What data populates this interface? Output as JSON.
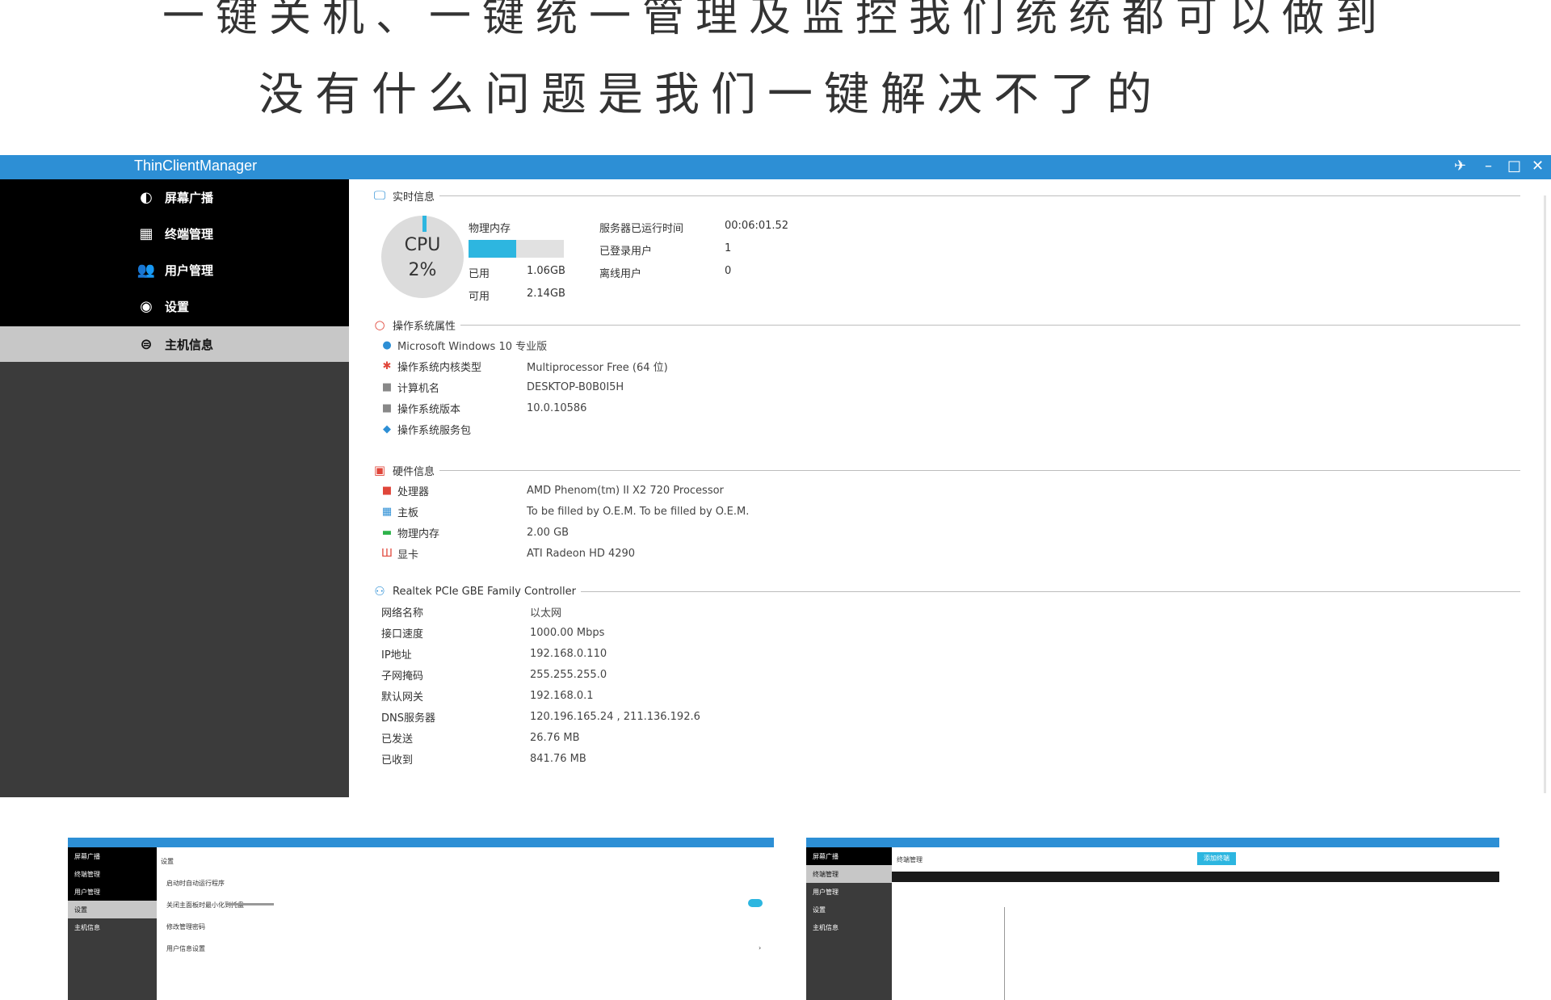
{
  "banner": {
    "line1": "一键关机、一键统一管理及监控我们统统都可以做到",
    "line2": "没有什么问题是我们一键解决不了的"
  },
  "window": {
    "title": "ThinClientManager",
    "controls": {
      "feedback": "✈",
      "minimize": "–",
      "maximize": "□",
      "close": "✕"
    }
  },
  "sidebar": {
    "items": [
      {
        "label": "屏幕广播",
        "icon": "broadcast-icon"
      },
      {
        "label": "终端管理",
        "icon": "terminal-icon"
      },
      {
        "label": "用户管理",
        "icon": "users-icon"
      },
      {
        "label": "设置",
        "icon": "settings-icon"
      },
      {
        "label": "主机信息",
        "icon": "host-info-icon",
        "active": true
      }
    ]
  },
  "realtime": {
    "title": "实时信息",
    "cpu_label": "CPU",
    "cpu_value": "2%",
    "cpu_fraction": 0.02,
    "mem_label": "物理内存",
    "mem_used_fraction": 0.5,
    "used_label": "已用",
    "used_value": "1.06GB",
    "avail_label": "可用",
    "avail_value": "2.14GB",
    "uptime_label": "服务器已运行时间",
    "uptime_value": "00:06:01.52",
    "logged_label": "已登录用户",
    "logged_value": "1",
    "offline_label": "离线用户",
    "offline_value": "0"
  },
  "os": {
    "title": "操作系统属性",
    "os_name": "Microsoft Windows 10 专业版",
    "rows": [
      {
        "label": "操作系统内核类型",
        "value": "Multiprocessor Free (64 位)",
        "icon": "kernel-icon"
      },
      {
        "label": "计算机名",
        "value": "DESKTOP-B0B0I5H",
        "icon": "computer-icon"
      },
      {
        "label": "操作系统版本",
        "value": "10.0.10586",
        "icon": "version-icon"
      },
      {
        "label": "操作系统服务包",
        "value": "",
        "icon": "service-pack-icon"
      }
    ]
  },
  "hardware": {
    "title": "硬件信息",
    "rows": [
      {
        "label": "处理器",
        "value": "AMD Phenom(tm) II X2 720 Processor",
        "icon": "cpu-icon"
      },
      {
        "label": "主板",
        "value": "To be filled by O.E.M. To be filled by O.E.M.",
        "icon": "motherboard-icon"
      },
      {
        "label": "物理内存",
        "value": "2.00 GB",
        "icon": "memory-icon"
      },
      {
        "label": "显卡",
        "value": "ATI Radeon HD 4290",
        "icon": "gpu-icon"
      }
    ]
  },
  "network": {
    "title": "Realtek PCIe GBE Family Controller",
    "rows": [
      {
        "label": "网络名称",
        "value": "以太网"
      },
      {
        "label": "接口速度",
        "value": "1000.00 Mbps"
      },
      {
        "label": "IP地址",
        "value": "192.168.0.110"
      },
      {
        "label": "子网掩码",
        "value": "255.255.255.0"
      },
      {
        "label": "默认网关",
        "value": "192.168.0.1"
      },
      {
        "label": "DNS服务器",
        "value": "120.196.165.24 , 211.136.192.6"
      },
      {
        "label": "已发送",
        "value": "26.76 MB"
      },
      {
        "label": "已收到",
        "value": "841.76 MB"
      }
    ]
  },
  "thumb1": {
    "nav": [
      "屏幕广播",
      "终端管理",
      "用户管理",
      "设置",
      "主机信息"
    ],
    "header": "设置",
    "rows": [
      "启动时自动运行程序",
      "关闭主面板时最小化到托盘",
      "修改管理密码",
      "用户信息设置"
    ]
  },
  "thumb2": {
    "nav": [
      "屏幕广播",
      "终端管理",
      "用户管理",
      "设置",
      "主机信息"
    ],
    "header": "终端管理",
    "button": "添加终端"
  }
}
